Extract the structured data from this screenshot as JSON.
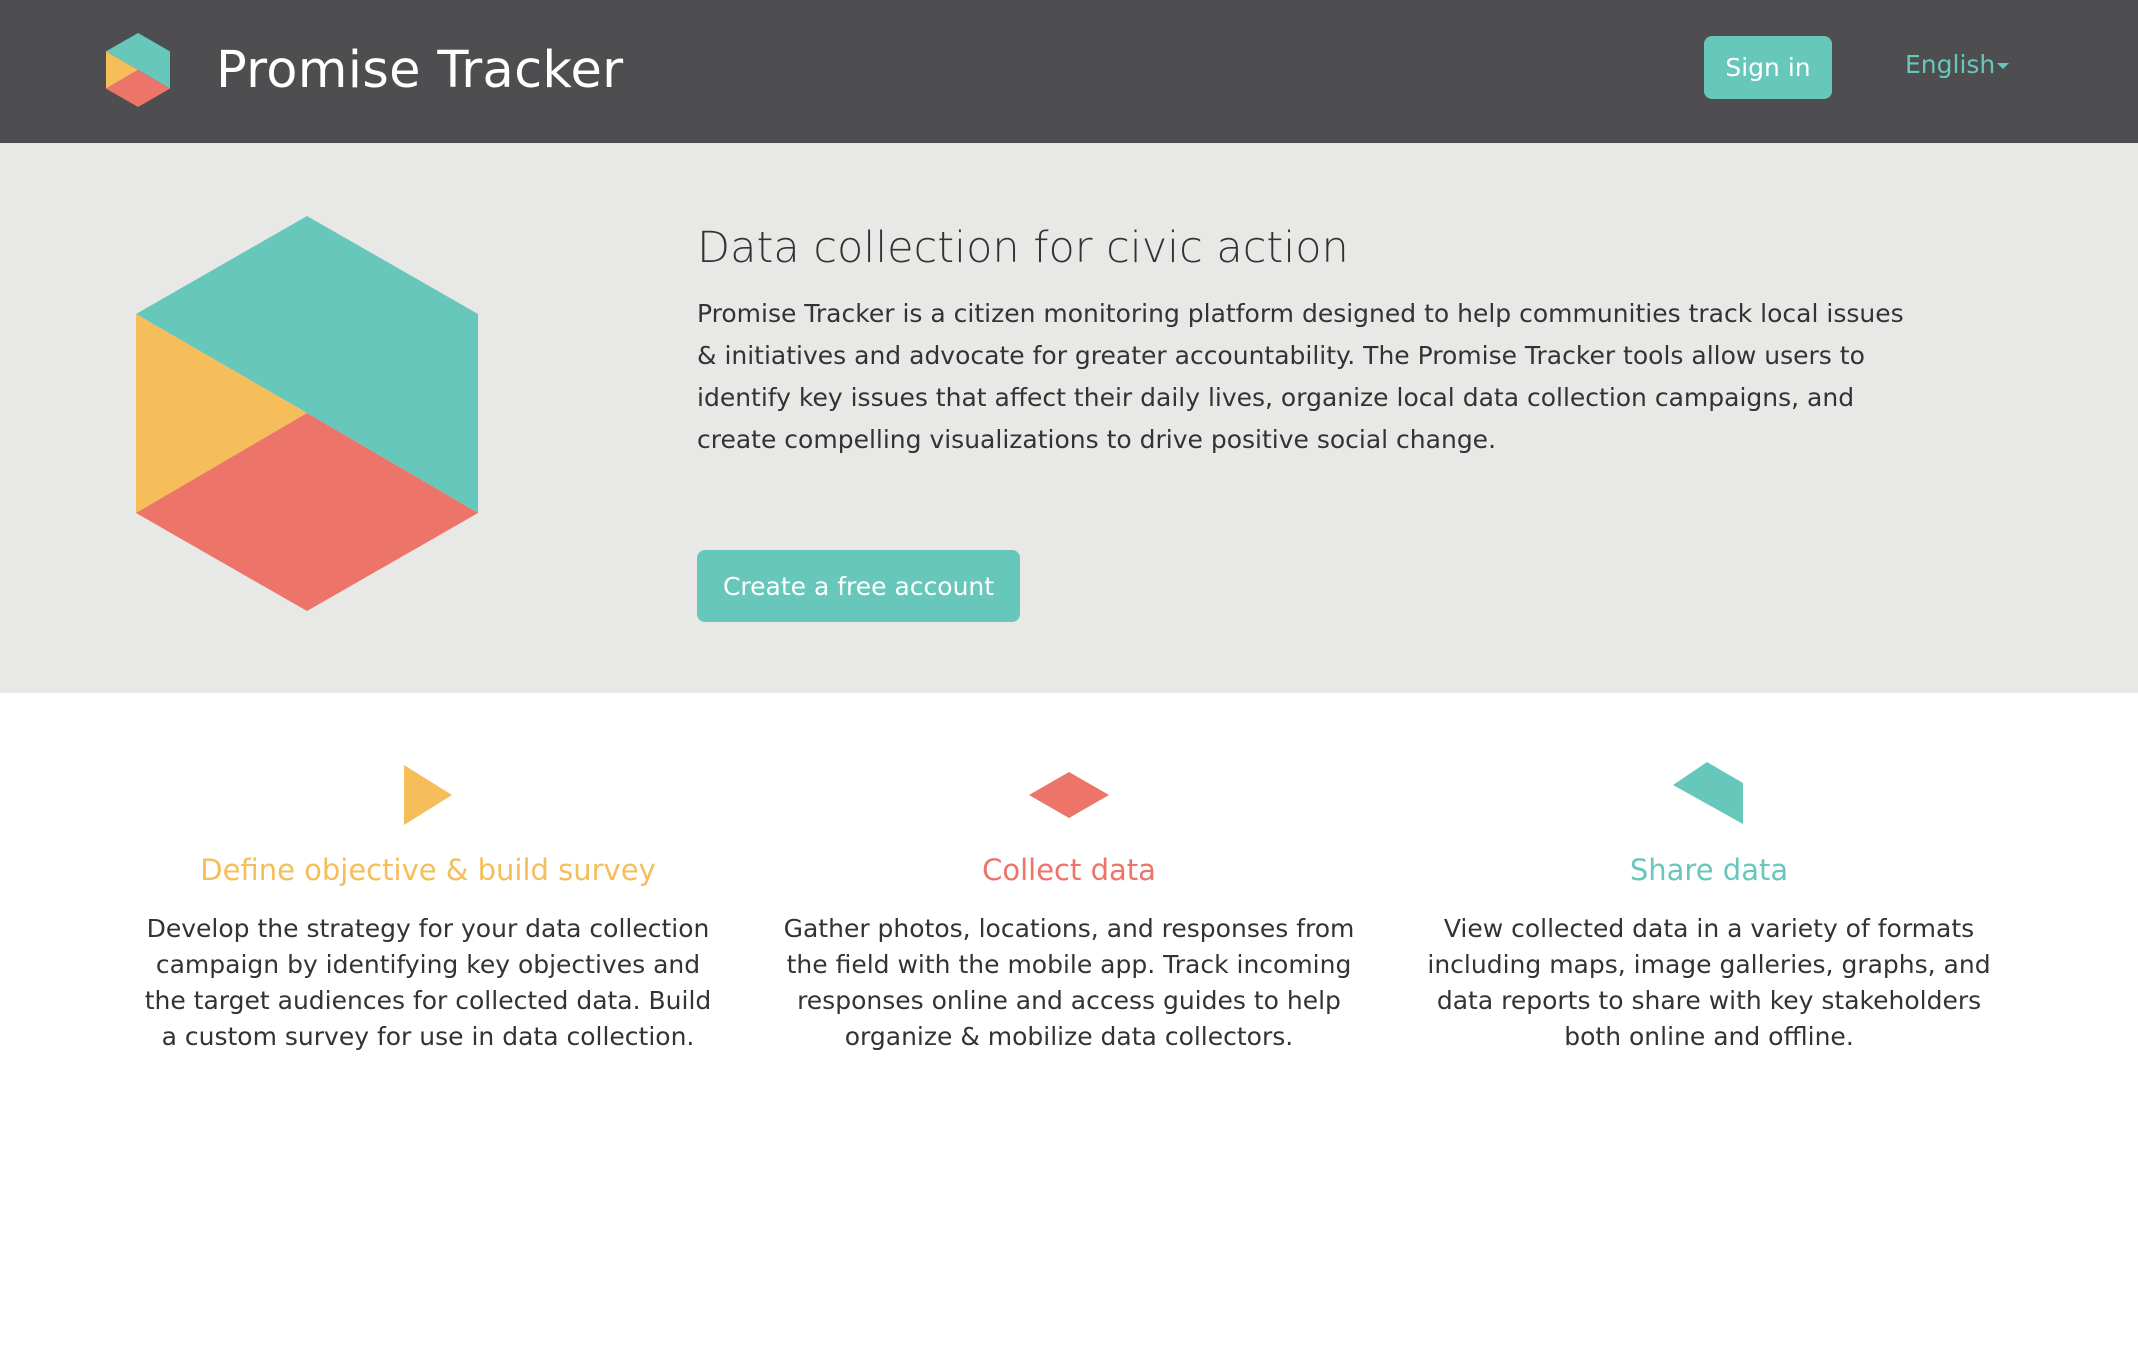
{
  "brand": {
    "name": "Promise Tracker",
    "logo_icon": "hexagon-logo-icon"
  },
  "header": {
    "signin_label": "Sign in",
    "language_label": "English"
  },
  "hero": {
    "title": "Data collection for civic action",
    "description": "Promise Tracker is a citizen monitoring platform designed to help communities track local issues & initiatives and advocate for greater accountability. The Promise Tracker tools allow users to identify key issues that affect their daily lives, organize local data collection campaigns, and create compelling visualizations to drive positive social change.",
    "cta_label": "Create a free account"
  },
  "features": [
    {
      "icon": "yellow-triangle-icon",
      "title": "Define objective & build survey",
      "description": "Develop the strategy for your data collection campaign by identifying key objectives and the target audiences for collected data. Build a custom survey for use in data collection.",
      "color": "#f5be5a"
    },
    {
      "icon": "coral-diamond-icon",
      "title": "Collect data",
      "description": "Gather photos, locations, and responses from the field with the mobile app. Track incoming responses online and access guides to help organize & mobilize data collectors.",
      "color": "#ec7468"
    },
    {
      "icon": "teal-quadrilateral-icon",
      "title": "Share data",
      "description": "View collected data in a variety of formats including maps, image galleries, graphs, and data reports to share with key stakeholders both online and offline.",
      "color": "#67c7bb"
    }
  ],
  "colors": {
    "header_bg": "#4e4e50",
    "accent": "#67c7bb",
    "hero_bg": "#e8e8e6",
    "yellow": "#f5be5a",
    "coral": "#ec7468"
  }
}
